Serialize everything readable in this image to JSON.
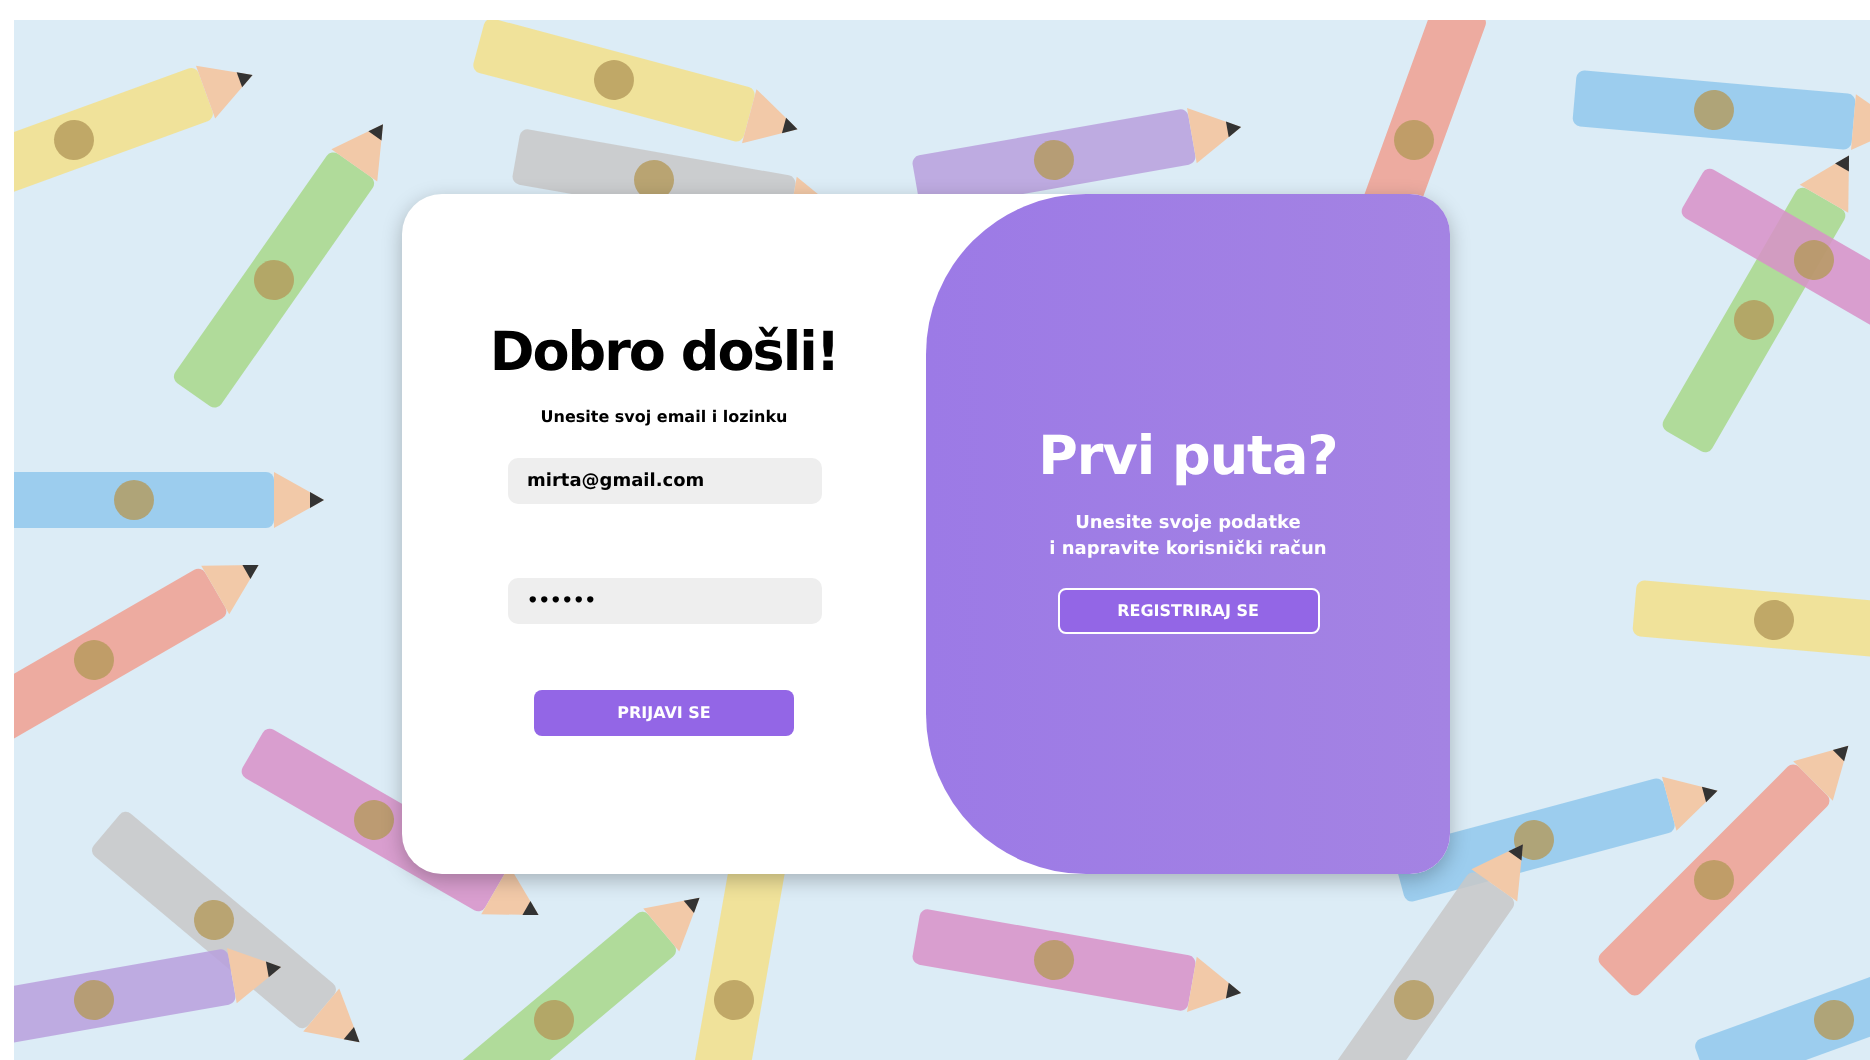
{
  "login": {
    "title": "Dobro došli!",
    "subtitle": "Unesite svoj email i lozinku",
    "fields": [
      {
        "kind": "email",
        "value": "mirta@gmail.com"
      },
      {
        "kind": "password",
        "value": "••••••"
      }
    ],
    "button": "PRIJAVI SE"
  },
  "signup": {
    "title": "Prvi puta?",
    "text_lines": [
      "Unesite svoje podatke",
      "i napravite korisnički račun"
    ],
    "button": "REGISTRIRAJ SE"
  }
}
